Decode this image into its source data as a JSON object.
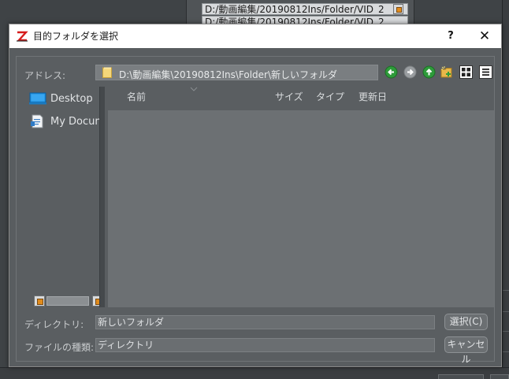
{
  "background": {
    "path_lines": [
      "D:/動画編集/20190812Ins/Folder/VID_2",
      "D:/動画編集/20190812Ins/Folder/VID_2"
    ]
  },
  "dialog": {
    "title": "目的フォルダを選択",
    "help_label": "?",
    "close_label": "✕",
    "address": {
      "label": "アドレス:",
      "path": "D:\\動画編集\\20190812Ins\\Folder\\新しいフォルダ"
    },
    "nav_icons": [
      "back-arrow-icon",
      "forward-arrow-icon",
      "up-arrow-icon",
      "new-folder-icon",
      "icon-view-icon",
      "list-view-icon"
    ],
    "places": [
      {
        "label": "Desktop",
        "icon": "desktop-icon"
      },
      {
        "label": "My Documents",
        "icon": "documents-icon"
      }
    ],
    "columns": {
      "name": "名前",
      "size": "サイズ",
      "type": "タイプ",
      "modified": "更新日"
    },
    "directory": {
      "label": "ディレクトリ:",
      "value": "新しいフォルダ"
    },
    "file_type": {
      "label": "ファイルの種類:",
      "value": "ディレクトリ"
    },
    "select_button": "選択(C)",
    "cancel_button": "キャンセル"
  },
  "colors": {
    "panel": "#5a5e61",
    "list_area": "#6c7073",
    "accent_orange": "#e08b1c",
    "nav_green": "#2e9b3a"
  }
}
